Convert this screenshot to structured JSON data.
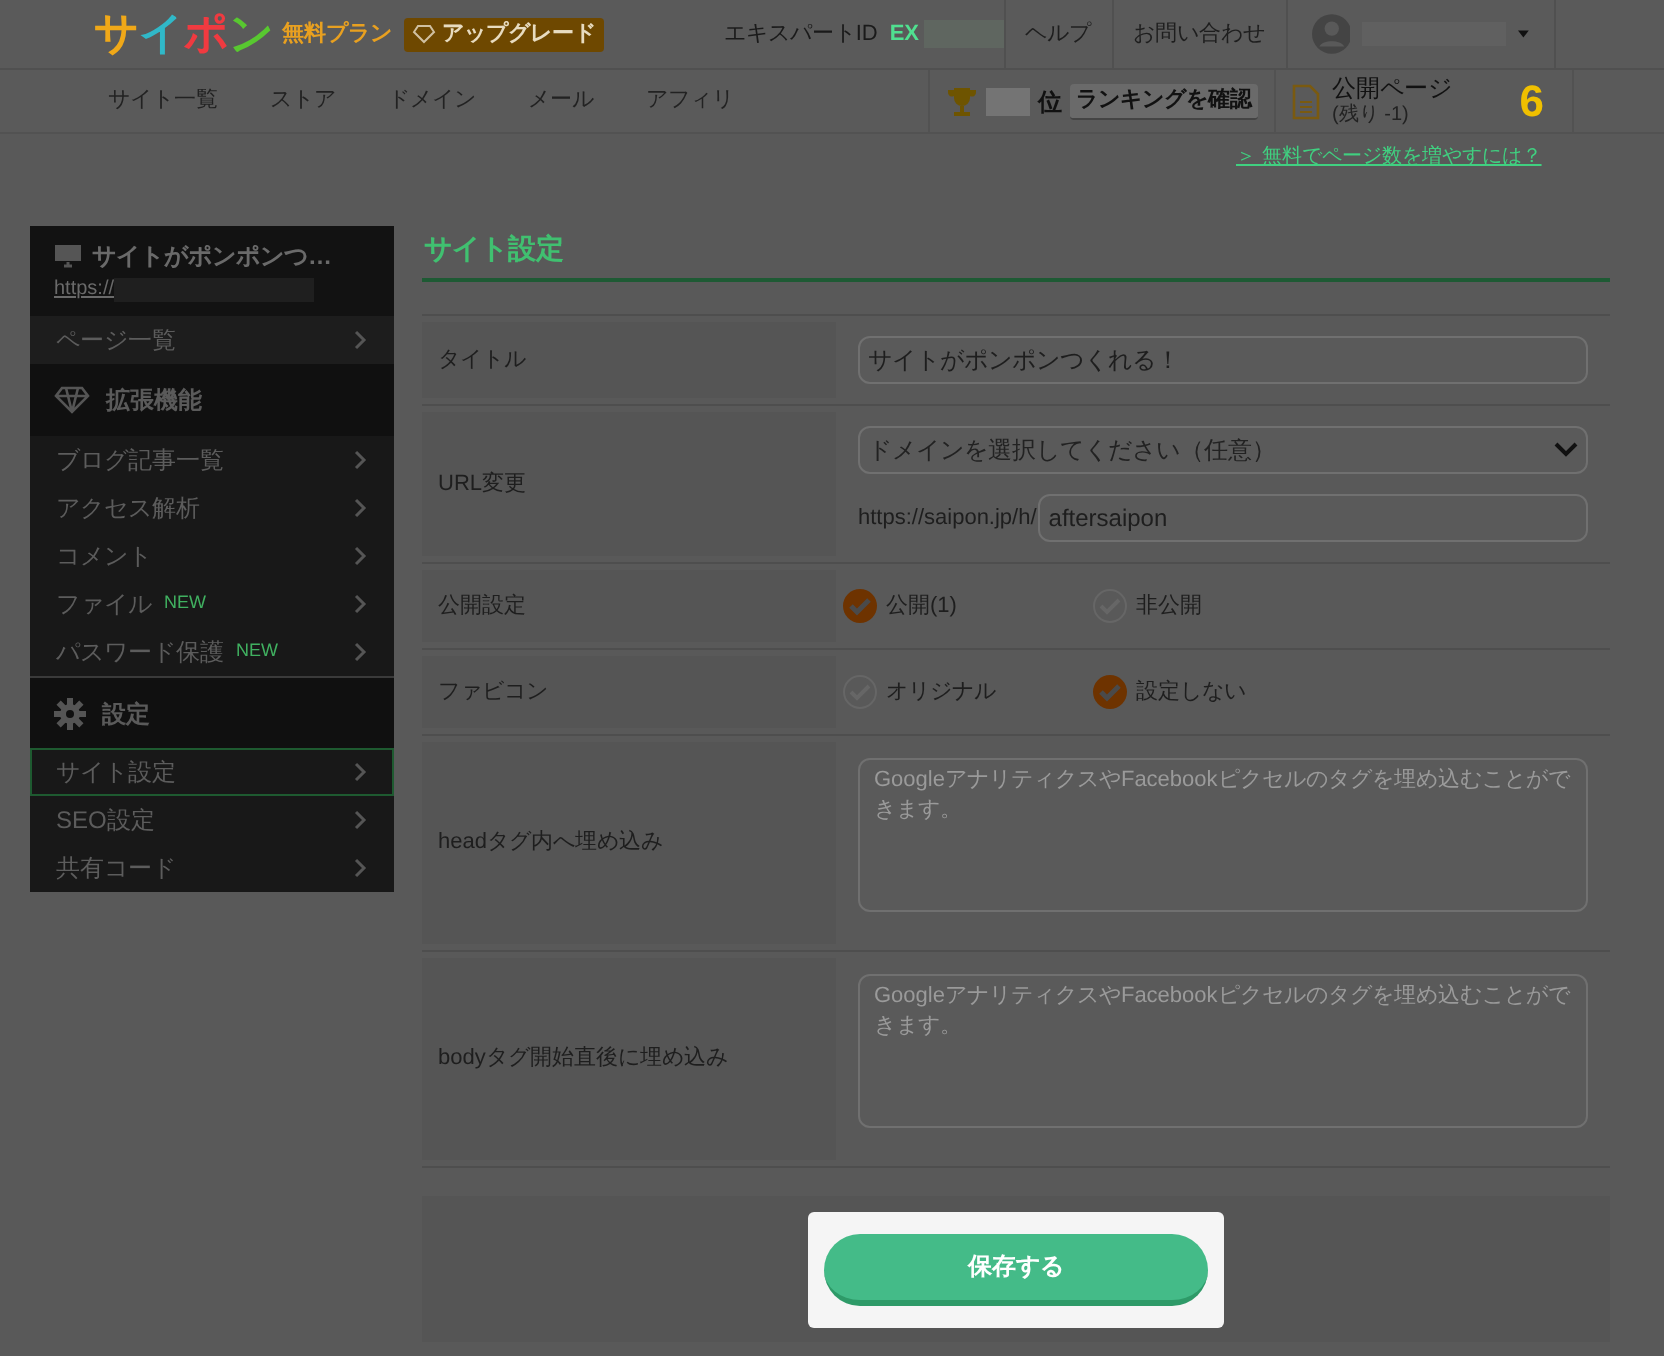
{
  "header": {
    "logo": "サイポン",
    "plan": "無料プラン",
    "upgrade": "アップグレード",
    "expert_id_label": "エキスパートID",
    "expert_id_prefix": "EX",
    "links": [
      "ヘルプ",
      "お問い合わせ"
    ]
  },
  "nav": [
    "サイト一覧",
    "ストア",
    "ドメイン",
    "メール",
    "アフィリ"
  ],
  "ranking": {
    "suffix": "位",
    "button": "ランキングを確認"
  },
  "pages": {
    "label": "公開ページ",
    "remaining": "(残り -1)",
    "count": "6"
  },
  "promo_link": "＞ 無料でページ数を増やすには？",
  "sidebar": {
    "site_name": "サイトがポンポンつ…",
    "site_url": "https://",
    "sections": [
      {
        "kind": "plain",
        "items": [
          {
            "label": "ページ一覧",
            "new": false,
            "selected": false
          }
        ]
      },
      {
        "kind": "extensions",
        "title": "拡張機能",
        "items": [
          {
            "label": "ブログ記事一覧",
            "new": false,
            "selected": false
          },
          {
            "label": "アクセス解析",
            "new": false,
            "selected": false
          },
          {
            "label": "コメント",
            "new": false,
            "selected": false
          },
          {
            "label": "ファイル",
            "new": true,
            "badge": "NEW",
            "selected": false
          },
          {
            "label": "パスワード保護",
            "new": true,
            "badge": "NEW",
            "selected": false
          }
        ]
      },
      {
        "kind": "settings",
        "title": "設定",
        "items": [
          {
            "label": "サイト設定",
            "new": false,
            "selected": true
          },
          {
            "label": "SEO設定",
            "new": false,
            "selected": false
          },
          {
            "label": "共有コード",
            "new": false,
            "selected": false
          }
        ]
      }
    ]
  },
  "form": {
    "title": "サイト設定",
    "rows": [
      {
        "kind": "text",
        "label": "タイトル",
        "value": "サイトがポンポンつくれる！"
      },
      {
        "kind": "url",
        "label": "URL変更",
        "select": "ドメインを選択してください（任意）",
        "prefix": "https://saipon.jp/h/",
        "value": "aftersaipon"
      },
      {
        "kind": "radio",
        "label": "公開設定",
        "options": [
          {
            "label": "公開(1)",
            "selected": true
          },
          {
            "label": "非公開",
            "selected": false
          }
        ]
      },
      {
        "kind": "radio",
        "label": "ファビコン",
        "options": [
          {
            "label": "オリジナル",
            "selected": false
          },
          {
            "label": "設定しない",
            "selected": true
          }
        ]
      },
      {
        "kind": "textarea",
        "label": "headタグ内へ埋め込み",
        "placeholder": "GoogleアナリティクスやFacebookピクセルのタグを埋め込むことができます。"
      },
      {
        "kind": "textarea",
        "label": "bodyタグ開始直後に埋め込み",
        "placeholder": "GoogleアナリティクスやFacebookピクセルのタグを埋め込むことができます。"
      }
    ],
    "save": "保存する"
  }
}
